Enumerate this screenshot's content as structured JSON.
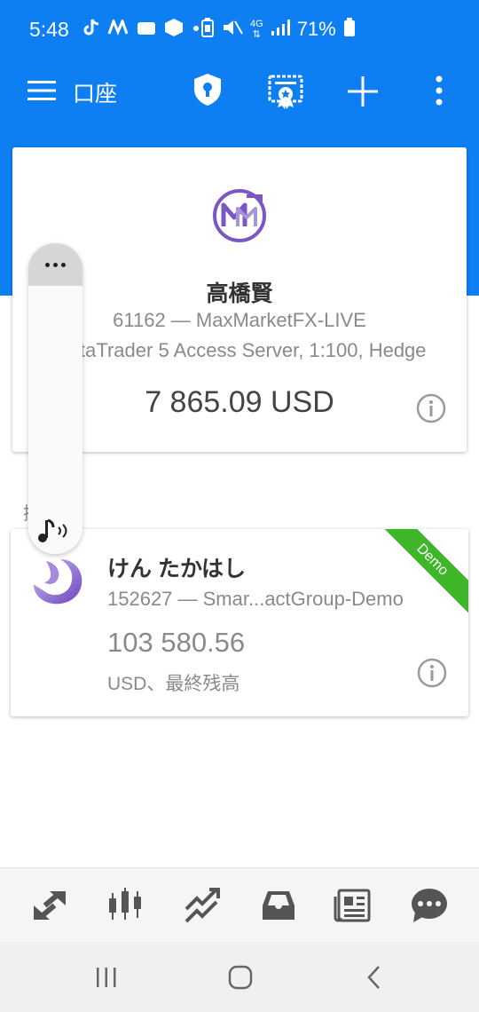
{
  "status_bar": {
    "time": "5:48",
    "battery": "71%",
    "network": "4G"
  },
  "app_bar": {
    "title": "口座",
    "icons": [
      "menu-icon",
      "shield-icon",
      "certificate-icon",
      "add-icon",
      "more-icon"
    ]
  },
  "account": {
    "name": "高橋賢",
    "account_line": "61162 — MaxMarketFX-LIVE",
    "server_line": "MetaTrader 5 Access Server, 1:100, Hedge",
    "balance": "7 865.09 USD"
  },
  "section": {
    "label": "接続先："
  },
  "demo_account": {
    "name": "けん たかはし",
    "account_line": "152627 — Smar...actGroup-Demo",
    "balance": "103 580.56",
    "balance_label": "USD、最終残高",
    "badge": "Demo"
  },
  "bottom_nav": {
    "items": [
      "quotes-icon",
      "chart-icon",
      "trade-icon",
      "mailbox-icon",
      "news-icon",
      "chat-icon"
    ]
  },
  "system_nav": {
    "items": [
      "recents-icon",
      "home-icon",
      "back-icon"
    ]
  },
  "colors": {
    "primary": "#0d7ff2",
    "demo_badge": "#3fb52a",
    "logo_purple": "#7b57c6",
    "icon_gray": "#555555"
  }
}
